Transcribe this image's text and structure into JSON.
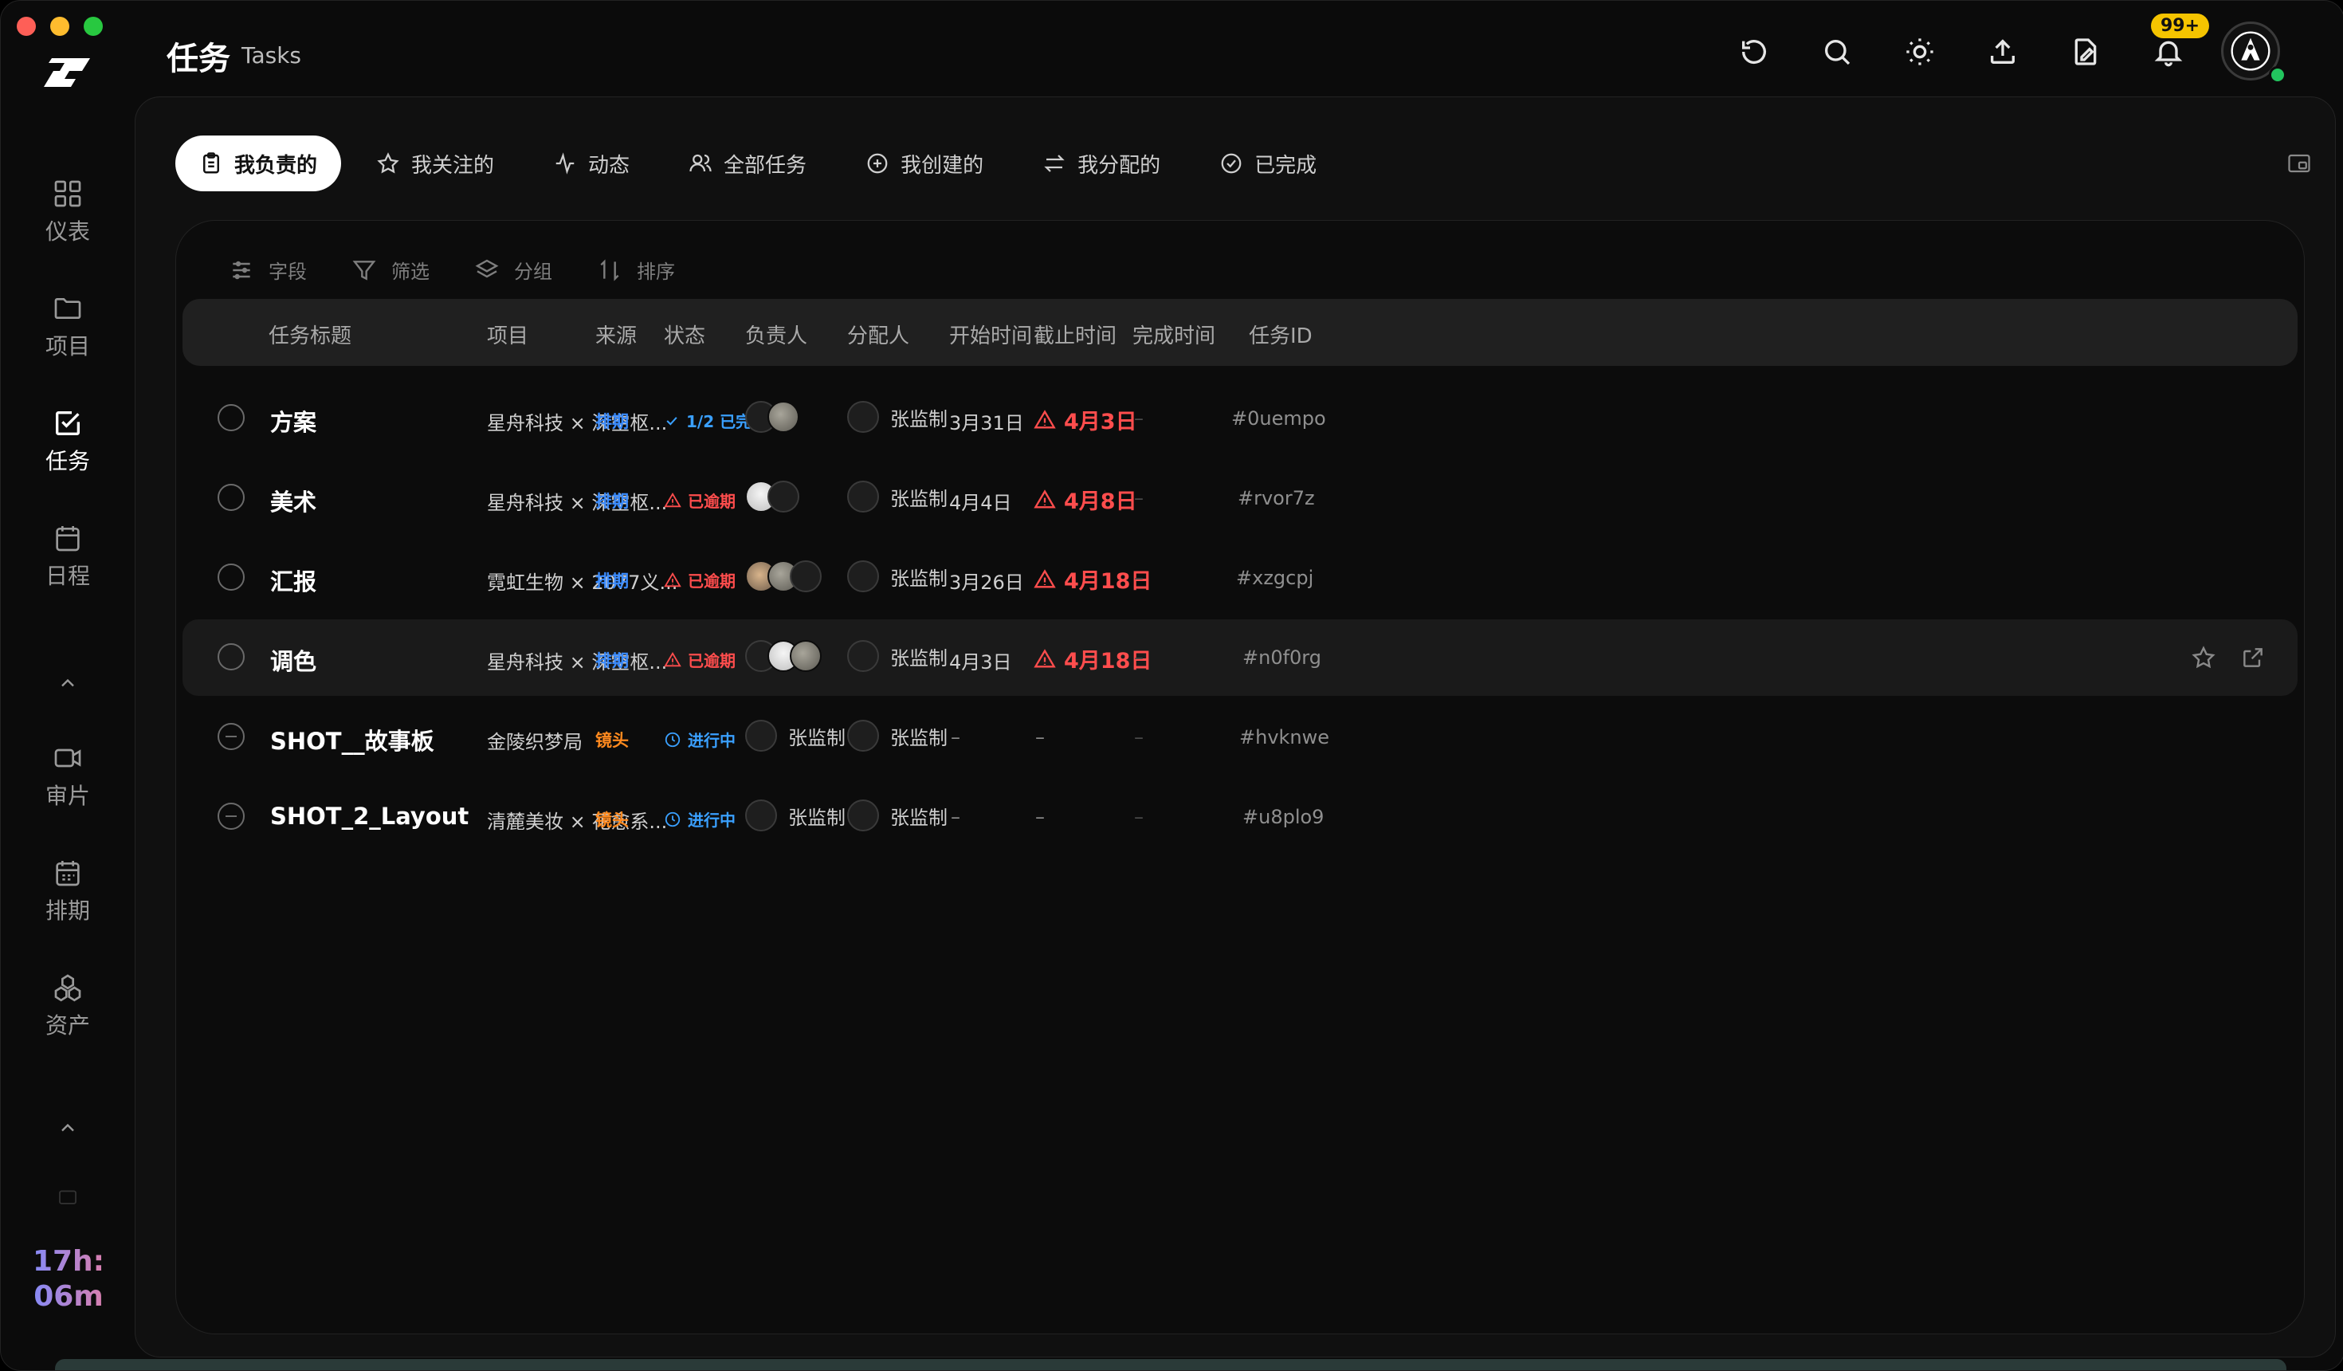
{
  "window": {
    "title": "任务",
    "subtitle": "Tasks"
  },
  "sidebar": {
    "items": [
      {
        "label": "仪表",
        "icon": "dashboard-icon"
      },
      {
        "label": "项目",
        "icon": "folder-icon"
      },
      {
        "label": "任务",
        "icon": "task-check-icon",
        "active": true
      },
      {
        "label": "日程",
        "icon": "calendar-icon"
      },
      {
        "label": "审片",
        "icon": "video-icon"
      },
      {
        "label": "排期",
        "icon": "schedule-icon"
      },
      {
        "label": "资产",
        "icon": "assets-icon"
      }
    ],
    "timer": {
      "line1": "17h:",
      "line2": "06m"
    }
  },
  "header": {
    "icons": [
      "refresh-icon",
      "search-icon",
      "theme-sun-icon",
      "upload-icon",
      "file-edit-icon",
      "bell-icon"
    ],
    "notification_badge": "99+"
  },
  "tabs": [
    {
      "label": "我负责的",
      "icon": "clipboard-icon",
      "active": true
    },
    {
      "label": "我关注的",
      "icon": "star-icon"
    },
    {
      "label": "动态",
      "icon": "activity-icon"
    },
    {
      "label": "全部任务",
      "icon": "users-icon"
    },
    {
      "label": "我创建的",
      "icon": "plus-circle-icon"
    },
    {
      "label": "我分配的",
      "icon": "swap-icon"
    },
    {
      "label": "已完成",
      "icon": "check-circle-icon"
    }
  ],
  "toolbar": [
    {
      "label": "字段",
      "icon": "sliders-icon"
    },
    {
      "label": "筛选",
      "icon": "filter-icon"
    },
    {
      "label": "分组",
      "icon": "layers-icon"
    },
    {
      "label": "排序",
      "icon": "sort-icon"
    }
  ],
  "table": {
    "headers": [
      "任务标题",
      "项目",
      "来源",
      "状态",
      "负责人",
      "分配人",
      "开始时间",
      "截止时间",
      "完成时间",
      "任务ID"
    ],
    "rows": [
      {
        "title": "方案",
        "project": "星舟科技 × 深空枢...",
        "source": "排期",
        "status": "1/2 已完成",
        "status_type": "done",
        "assignee": "",
        "assigner": "张监制",
        "start": "3月31日",
        "due": "4月3日",
        "due_overdue": true,
        "completed": "–",
        "id": "#0uempo"
      },
      {
        "title": "美术",
        "project": "星舟科技 × 深空枢...",
        "source": "排期",
        "status": "已逾期",
        "status_type": "overdue",
        "assignee": "",
        "assigner": "张监制",
        "start": "4月4日",
        "due": "4月8日",
        "due_overdue": true,
        "completed": "–",
        "id": "#rvor7z"
      },
      {
        "title": "汇报",
        "project": "霓虹生物 × 2077义...",
        "source": "排期",
        "status": "已逾期",
        "status_type": "overdue",
        "assignee": "",
        "assigner": "张监制",
        "start": "3月26日",
        "due": "4月18日",
        "due_overdue": true,
        "completed": "–",
        "id": "#xzgcpj"
      },
      {
        "title": "调色",
        "project": "星舟科技 × 深空枢...",
        "source": "排期",
        "status": "已逾期",
        "status_type": "overdue",
        "assignee": "",
        "assigner": "张监制",
        "start": "4月3日",
        "due": "4月18日",
        "due_overdue": true,
        "completed": "–",
        "id": "#n0f0rg"
      },
      {
        "title": "SHOT__故事板",
        "project": "金陵织梦局",
        "source": "镜头",
        "status": "进行中",
        "status_type": "progress",
        "assignee": "张监制",
        "assigner": "张监制",
        "start": "–",
        "due": "–",
        "due_overdue": false,
        "completed": "–",
        "id": "#hvknwe"
      },
      {
        "title": "SHOT_2_Layout",
        "project": "清麓美妆 × 花愈系...",
        "source": "镜头",
        "status": "进行中",
        "status_type": "progress",
        "assignee": "张监制",
        "assigner": "张监制",
        "start": "–",
        "due": "–",
        "due_overdue": false,
        "completed": "–",
        "id": "#u8plo9"
      }
    ]
  },
  "colors": {
    "accent_blue": "#3b8cff",
    "overdue_red": "#ff4d4d",
    "source_orange": "#ff8a1f",
    "badge_yellow": "#f5c400",
    "online_green": "#22c55e"
  }
}
